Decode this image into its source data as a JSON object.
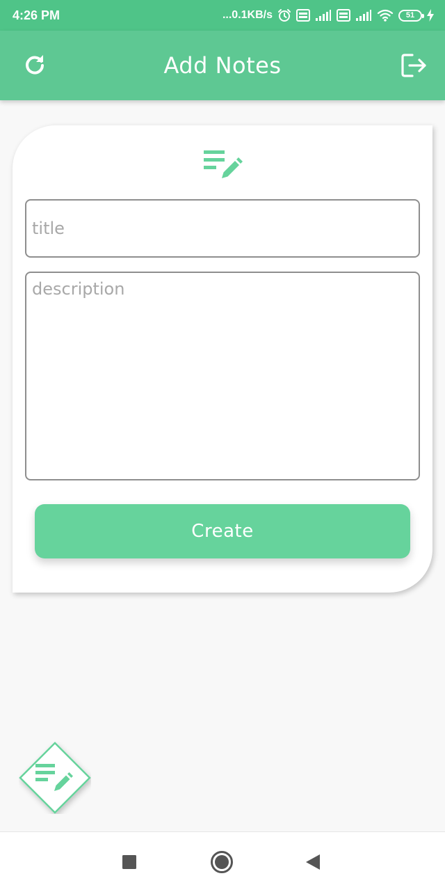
{
  "status_bar": {
    "time": "4:26 PM",
    "network_speed": "...0.1KB/s",
    "battery_level": "51",
    "icons": [
      "alarm-icon",
      "volte-icon",
      "signal-icon",
      "volte-icon",
      "signal-icon",
      "wifi-icon",
      "battery-icon",
      "charging-icon"
    ]
  },
  "app_bar": {
    "title": "Add Notes",
    "left_icon": "refresh-icon",
    "right_icon": "logout-icon",
    "color": "#5ec893"
  },
  "form": {
    "header_icon": "edit-note-icon",
    "title_placeholder": "title",
    "title_value": "",
    "description_placeholder": "description",
    "description_value": "",
    "create_label": "Create",
    "button_color": "#66d39c"
  },
  "fab": {
    "icon": "edit-note-icon",
    "accent_color": "#66d39c"
  },
  "nav_bar": {
    "buttons": [
      "recent-apps-icon",
      "home-icon",
      "back-icon"
    ]
  },
  "colors": {
    "status_bar": "#4fc488",
    "background": "#f8f8f8",
    "card": "#ffffff"
  }
}
